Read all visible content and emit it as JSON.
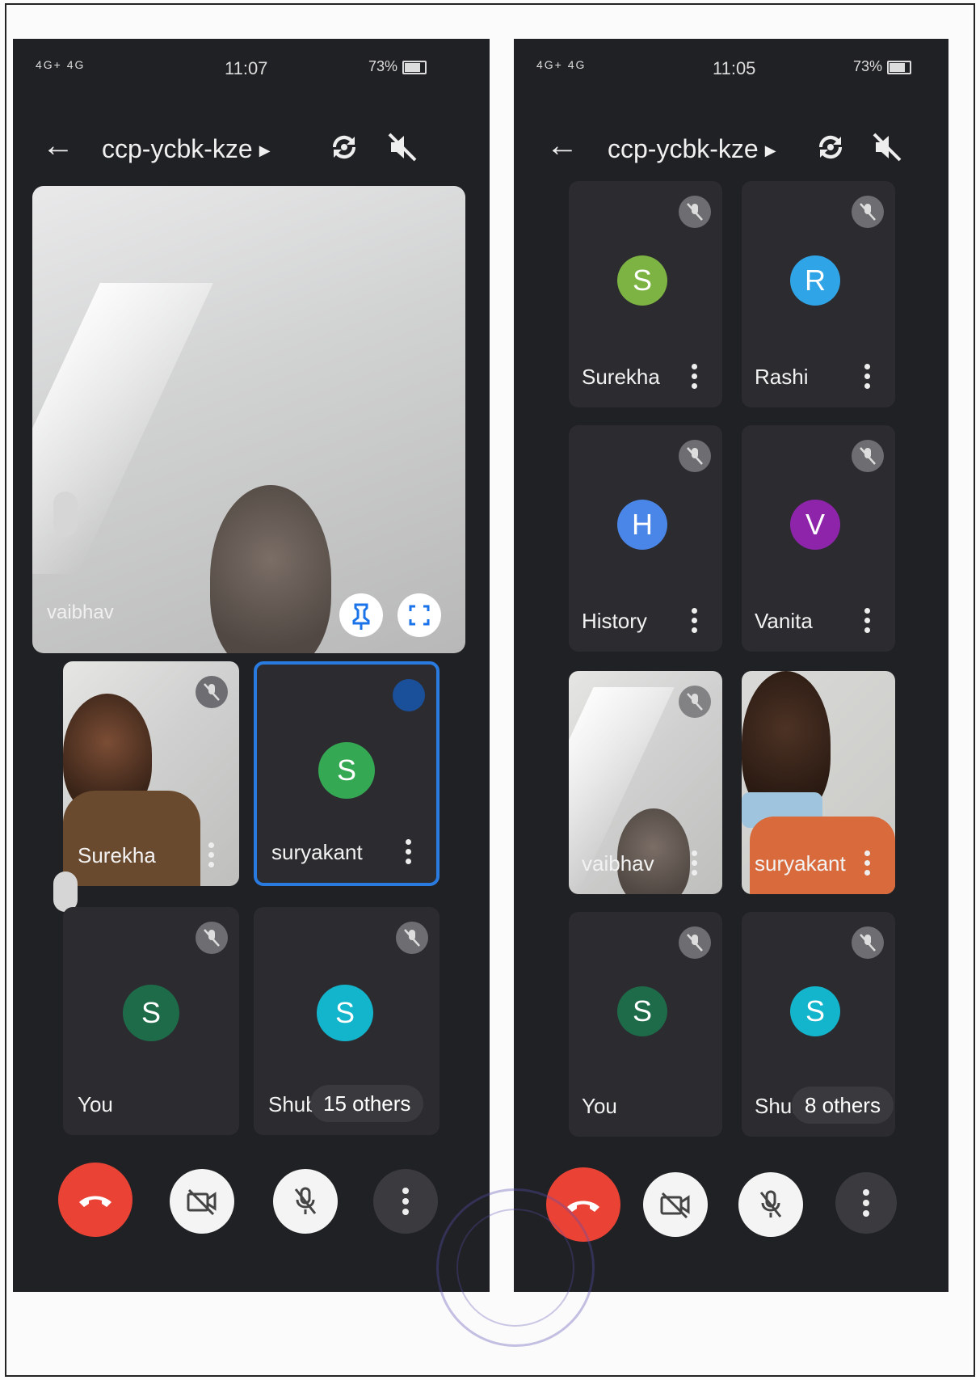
{
  "left": {
    "status": {
      "network": "4G+ 4G",
      "time": "11:07",
      "battery": "73%"
    },
    "meeting_code": "ccp-ycbk-kze",
    "main_video_name": "vaibhav",
    "tiles": [
      {
        "name": "Surekha",
        "initial": ""
      },
      {
        "name": "suryakant",
        "initial": "S",
        "color": "#34a853"
      },
      {
        "name": "You",
        "initial": "S",
        "color": "#1e6b4a"
      },
      {
        "name": "Shub",
        "initial": "S",
        "color": "#12b5cb"
      }
    ],
    "others_label": "15 others"
  },
  "right": {
    "status": {
      "network": "4G+ 4G",
      "time": "11:05",
      "battery": "73%"
    },
    "meeting_code": "ccp-ycbk-kze",
    "tiles": [
      {
        "name": "Surekha",
        "initial": "S",
        "color": "#7cb342"
      },
      {
        "name": "Rashi",
        "initial": "R",
        "color": "#2fa4e7"
      },
      {
        "name": "History",
        "initial": "H",
        "color": "#4a86e8"
      },
      {
        "name": "Vanita",
        "initial": "V",
        "color": "#8e24aa"
      },
      {
        "name": "vaibhav",
        "initial": ""
      },
      {
        "name": "suryakant",
        "initial": ""
      },
      {
        "name": "You",
        "initial": "S",
        "color": "#1e6b4a"
      },
      {
        "name": "Shubl",
        "initial": "S",
        "color": "#12b5cb"
      }
    ],
    "others_label": "8 others"
  },
  "icons": [
    "back-arrow-icon",
    "switch-camera-icon",
    "speaker-off-icon",
    "mic-off-icon",
    "more-vert-icon",
    "pin-icon",
    "fullscreen-icon",
    "end-call-icon",
    "camera-off-icon"
  ]
}
